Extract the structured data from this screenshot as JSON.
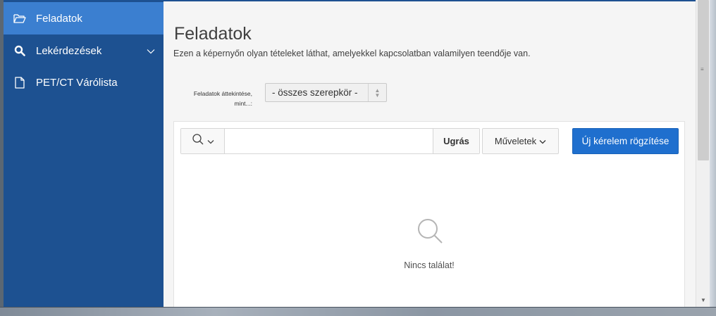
{
  "sidebar": {
    "items": [
      {
        "label": "Feladatok",
        "icon": "folder-open-icon",
        "active": true
      },
      {
        "label": "Lekérdezések",
        "icon": "search-icon",
        "has_submenu": true
      },
      {
        "label": "PET/CT Várólista",
        "icon": "document-icon"
      }
    ]
  },
  "page": {
    "title": "Feladatok",
    "subtitle": "Ezen a képernyőn olyan tételeket láthat, amelyekkel kapcsolatban valamilyen teendője van."
  },
  "filter": {
    "label_line1": "Feladatok áttekintése,",
    "label_line2": "mint...:",
    "selected": "- összes szerepkör -"
  },
  "report": {
    "search_placeholder": "",
    "search_value": "",
    "go_label": "Ugrás",
    "actions_label": "Műveletek",
    "new_label": "Új kérelem rögzítése",
    "empty_message": "Nincs találat!"
  },
  "colors": {
    "sidebar_bg": "#1d5191",
    "sidebar_active": "#3b7fd0",
    "primary_button": "#1f6fce"
  }
}
